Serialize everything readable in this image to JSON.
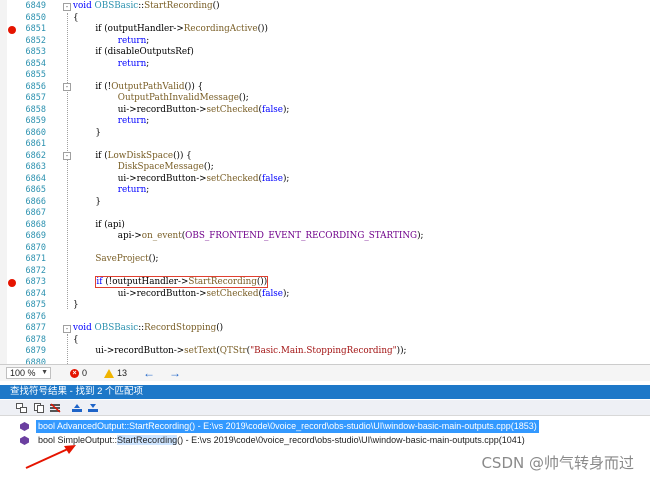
{
  "editor": {
    "lines": [
      {
        "n": "6849",
        "html": "<span class=\"kw\">void</span> <span class=\"cls\">OBSBasic</span>::<span class=\"fn\">StartRecording</span>()",
        "fold": "-",
        "bp": false
      },
      {
        "n": "6850",
        "html": "{",
        "bp": false
      },
      {
        "n": "6851",
        "html": "\tif (outputHandler-><span class=\"fn\">RecordingActive</span>())",
        "bp": true
      },
      {
        "n": "6852",
        "html": "\t\t<span class=\"kw\">return</span>;",
        "bp": false
      },
      {
        "n": "6853",
        "html": "\tif (disableOutputsRef)",
        "bp": false
      },
      {
        "n": "6854",
        "html": "\t\t<span class=\"kw\">return</span>;",
        "bp": false
      },
      {
        "n": "6855",
        "html": "",
        "bp": false
      },
      {
        "n": "6856",
        "html": "\tif (!<span class=\"fn\">OutputPathValid</span>()) {",
        "fold": "-",
        "bp": false
      },
      {
        "n": "6857",
        "html": "\t\t<span class=\"fn\">OutputPathInvalidMessage</span>();",
        "bp": false
      },
      {
        "n": "6858",
        "html": "\t\tui->recordButton-><span class=\"fn\">setChecked</span>(<span class=\"kw\">false</span>);",
        "bp": false
      },
      {
        "n": "6859",
        "html": "\t\t<span class=\"kw\">return</span>;",
        "bp": false
      },
      {
        "n": "6860",
        "html": "\t}",
        "bp": false
      },
      {
        "n": "6861",
        "html": "",
        "bp": false
      },
      {
        "n": "6862",
        "html": "\tif (<span class=\"fn\">LowDiskSpace</span>()) {",
        "fold": "-",
        "bp": false
      },
      {
        "n": "6863",
        "html": "\t\t<span class=\"fn\">DiskSpaceMessage</span>();",
        "bp": false
      },
      {
        "n": "6864",
        "html": "\t\tui->recordButton-><span class=\"fn\">setChecked</span>(<span class=\"kw\">false</span>);",
        "bp": false
      },
      {
        "n": "6865",
        "html": "\t\t<span class=\"kw\">return</span>;",
        "bp": false
      },
      {
        "n": "6866",
        "html": "\t}",
        "bp": false
      },
      {
        "n": "6867",
        "html": "",
        "bp": false
      },
      {
        "n": "6868",
        "html": "\tif (api)",
        "bp": false
      },
      {
        "n": "6869",
        "html": "\t\tapi-><span class=\"fn\">on_event</span>(<span class=\"mac\">OBS_FRONTEND_EVENT_RECORDING_STARTING</span>);",
        "bp": false
      },
      {
        "n": "6870",
        "html": "",
        "bp": false
      },
      {
        "n": "6871",
        "html": "\t<span class=\"fn\">SaveProject</span>();",
        "bp": false
      },
      {
        "n": "6872",
        "html": "",
        "bp": false
      },
      {
        "n": "6873",
        "html": "\t<span class=\"hl\"><span class=\"kw\">if</span> (!outputHandler-><span class=\"fn\">StartRecording</span>())</span>",
        "bp": true
      },
      {
        "n": "6874",
        "html": "\t\tui->recordButton-><span class=\"fn\">setChecked</span>(<span class=\"kw\">false</span>);",
        "bp": false
      },
      {
        "n": "6875",
        "html": "}",
        "bp": false
      },
      {
        "n": "6876",
        "html": "",
        "bp": false
      },
      {
        "n": "6877",
        "html": "<span class=\"kw\">void</span> <span class=\"cls\">OBSBasic</span>::<span class=\"fn\">RecordStopping</span>()",
        "fold": "-",
        "bp": false
      },
      {
        "n": "6878",
        "html": "{",
        "bp": false
      },
      {
        "n": "6879",
        "html": "\tui->recordButton-><span class=\"fn\">setText</span>(<span class=\"fn\">QTStr</span>(<span class=\"str\">\"Basic.Main.StoppingRecording\"</span>));",
        "bp": false
      },
      {
        "n": "6880",
        "html": "",
        "bp": false
      }
    ]
  },
  "status_bar": {
    "zoom": "100 %",
    "errors": "0",
    "warnings": "13",
    "colors": {
      "error": "#e51400",
      "warning": "#f0b400",
      "nav": "#1e64c8"
    }
  },
  "results_panel": {
    "title": "查找符号结果 - 找到 2 个匹配项",
    "accent": "#1e78c8",
    "results": [
      {
        "prefix": "bool AdvancedOutput::",
        "match": "StartRecording",
        "suffix": "() - E:\\vs 2019\\code\\0voice_record\\obs-studio\\UI\\window-basic-main-outputs.cpp(1853)",
        "selected": true
      },
      {
        "prefix": "bool SimpleOutput::",
        "match": "StartRecording",
        "suffix": "() - E:\\vs 2019\\code\\0voice_record\\obs-studio\\UI\\window-basic-main-outputs.cpp(1041)",
        "selected": false
      }
    ]
  },
  "watermark": "CSDN @帅气转身而过"
}
